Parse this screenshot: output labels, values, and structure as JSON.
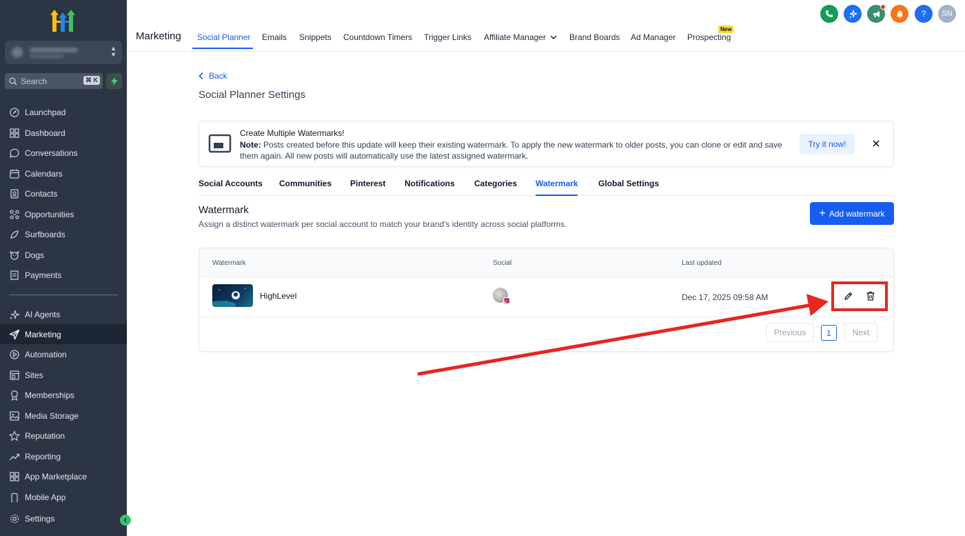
{
  "sidebar": {
    "search_placeholder": "Search",
    "search_shortcut": "⌘ K",
    "items": [
      {
        "label": "Launchpad",
        "icon": "rocket-icon"
      },
      {
        "label": "Dashboard",
        "icon": "grid-icon"
      },
      {
        "label": "Conversations",
        "icon": "chat-icon"
      },
      {
        "label": "Calendars",
        "icon": "calendar-icon"
      },
      {
        "label": "Contacts",
        "icon": "contacts-icon"
      },
      {
        "label": "Opportunities",
        "icon": "funnel-icon"
      },
      {
        "label": "Surfboards",
        "icon": "surfboard-icon"
      },
      {
        "label": "Dogs",
        "icon": "dog-icon"
      },
      {
        "label": "Payments",
        "icon": "receipt-icon"
      },
      {
        "label": "AI Agents",
        "icon": "sparkle-icon"
      },
      {
        "label": "Marketing",
        "icon": "send-icon"
      },
      {
        "label": "Automation",
        "icon": "automation-icon"
      },
      {
        "label": "Sites",
        "icon": "sites-icon"
      },
      {
        "label": "Memberships",
        "icon": "award-icon"
      },
      {
        "label": "Media Storage",
        "icon": "image-icon"
      },
      {
        "label": "Reputation",
        "icon": "star-icon"
      },
      {
        "label": "Reporting",
        "icon": "trend-icon"
      },
      {
        "label": "App Marketplace",
        "icon": "apps-icon"
      },
      {
        "label": "Mobile App",
        "icon": "mobile-icon"
      }
    ],
    "settings_label": "Settings"
  },
  "topnav": {
    "brand": "Marketing",
    "tabs": [
      "Social Planner",
      "Emails",
      "Snippets",
      "Countdown Timers",
      "Trigger Links",
      "Affiliate Manager",
      "Brand Boards",
      "Ad Manager",
      "Prospecting"
    ],
    "new_badge": "New",
    "avatar_initials": "SN",
    "help": "?"
  },
  "page": {
    "back": "Back",
    "title": "Social Planner Settings"
  },
  "banner": {
    "title": "Create Multiple Watermarks!",
    "note_label": "Note:",
    "note_text": "Posts created before this update will keep their existing watermark. To apply the new watermark to older posts, you can clone or edit and save them again. All new posts will automatically use the latest assigned watermark.",
    "cta": "Try it now!"
  },
  "subtabs": [
    "Social Accounts",
    "Communities",
    "Pinterest",
    "Notifications",
    "Categories",
    "Watermark",
    "Global Settings"
  ],
  "watermark": {
    "title": "Watermark",
    "description": "Assign a distinct watermark per social account to match your brand's identity across social platforms.",
    "add_button": "Add watermark",
    "columns": [
      "Watermark",
      "Social",
      "Last updated"
    ],
    "rows": [
      {
        "name": "HighLevel",
        "last_updated": "Dec 17, 2025 09:58 AM"
      }
    ],
    "pager": {
      "previous": "Previous",
      "page": "1",
      "next": "Next"
    }
  },
  "colors": {
    "accent": "#155eef",
    "sidebar": "#2b3544",
    "highlight": "#e8251f"
  }
}
